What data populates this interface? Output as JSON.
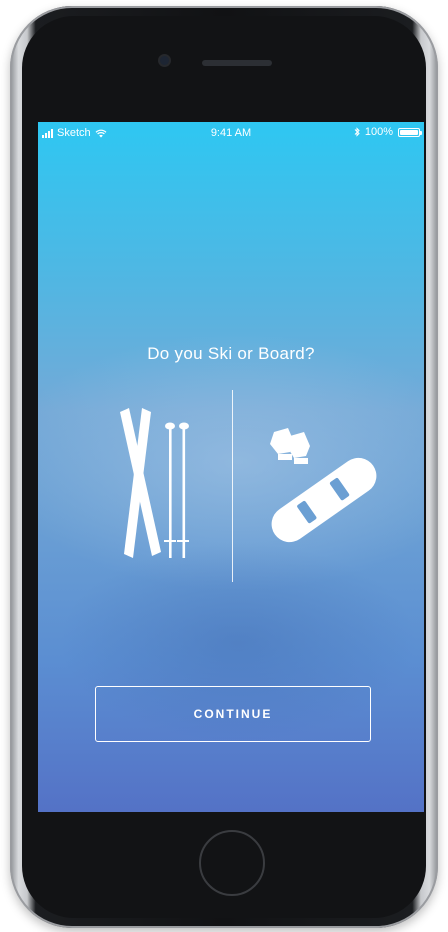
{
  "status_bar": {
    "carrier": "Sketch",
    "time": "9:41 AM",
    "battery": "100%",
    "icons": [
      "signal-icon",
      "wifi-icon",
      "bluetooth-icon",
      "battery-icon"
    ]
  },
  "main": {
    "question": "Do you Ski or Board?",
    "options": [
      {
        "name": "ski",
        "icon": "ski-poles-icon"
      },
      {
        "name": "board",
        "icon": "snowboard-gloves-icon"
      }
    ],
    "continue_label": "CONTINUE"
  },
  "colors": {
    "gradient_top": "#2ec7f2",
    "gradient_bottom": "#5472c6",
    "foreground": "#ffffff"
  }
}
